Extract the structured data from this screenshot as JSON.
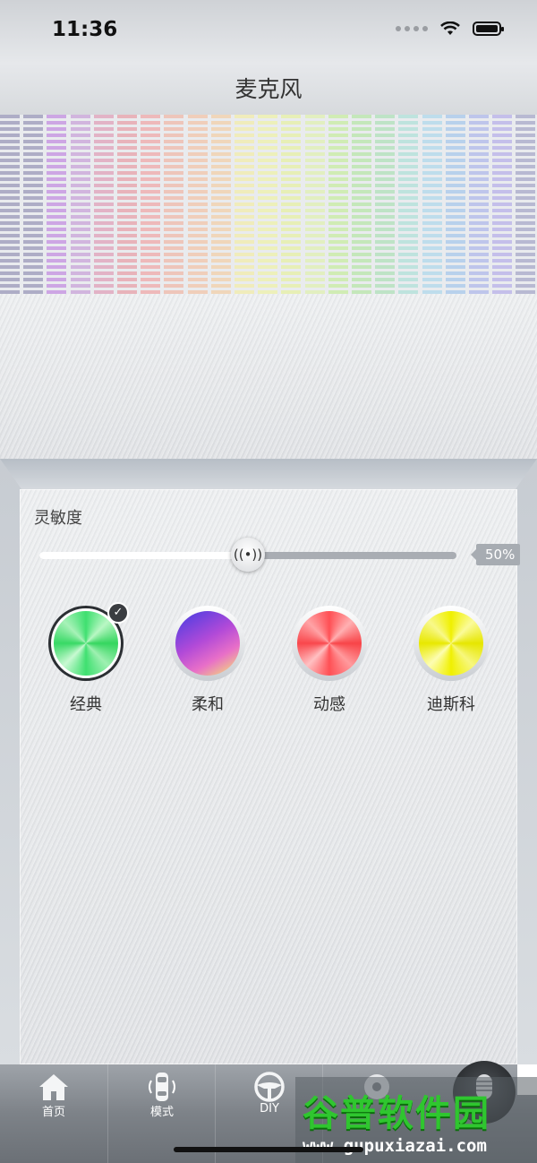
{
  "status_bar": {
    "time": "11:36"
  },
  "nav": {
    "title": "麦克风"
  },
  "sensitivity": {
    "label": "灵敏度",
    "value_text": "50%",
    "value": 0.5
  },
  "modes": [
    {
      "label": "经典",
      "selected": true
    },
    {
      "label": "柔和",
      "selected": false
    },
    {
      "label": "动感",
      "selected": false
    },
    {
      "label": "迪斯科",
      "selected": false
    }
  ],
  "tabs": [
    {
      "label": "首页",
      "icon": "home-icon"
    },
    {
      "label": "模式",
      "icon": "car-icon"
    },
    {
      "label": "DIY",
      "icon": "steering-wheel-icon"
    },
    {
      "label": "",
      "icon": "music-disc-icon"
    },
    {
      "label": "",
      "icon": "microphone-icon"
    }
  ],
  "watermark": {
    "title": "谷普软件园",
    "url": "www.gupuxiazai.com"
  },
  "colors": {
    "slider_fill": "#ffffff",
    "slider_track": "#a9adb3",
    "tabbar": "#7d8288"
  }
}
